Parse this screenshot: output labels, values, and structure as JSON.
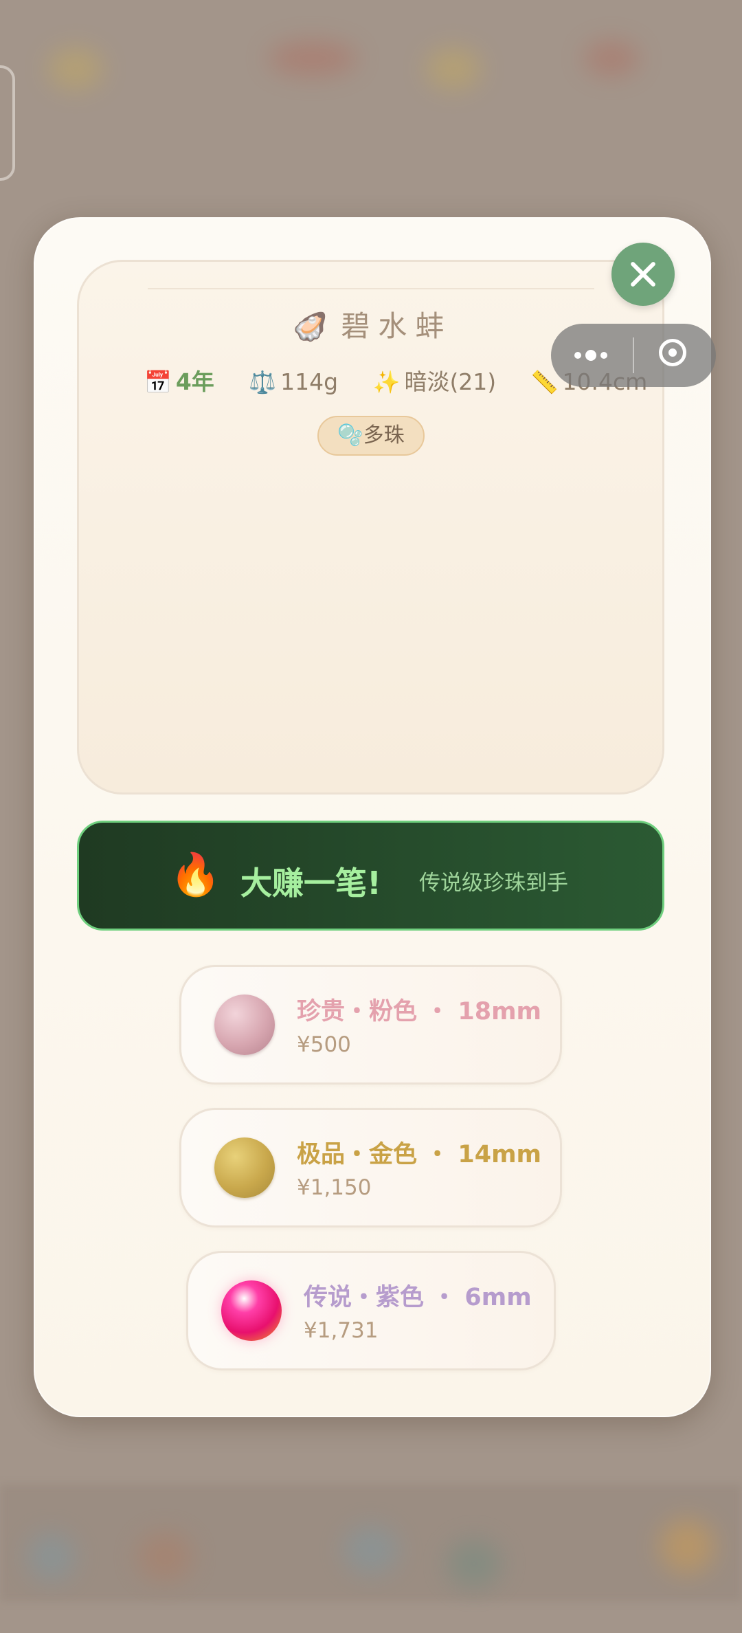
{
  "oyster": {
    "icon": "🦪",
    "name": "碧水蚌",
    "stats": {
      "age_icon": "📅",
      "age": "4年",
      "weight_icon": "⚖️",
      "weight": "114g",
      "luster_icon": "✨",
      "luster": "暗淡(21)",
      "size_icon": "📏",
      "size": "10.4cm"
    },
    "tag_icon": "🫧",
    "tag": "多珠"
  },
  "banner": {
    "icon": "🔥",
    "headline": "大赚一笔!",
    "subline": "传说级珍珠到手"
  },
  "pearls": [
    {
      "name": "珍贵・粉色 ・ 18mm",
      "price": "¥500",
      "color": "#e4a1ad"
    },
    {
      "name": "极品・金色 ・ 14mm",
      "price": "¥1,150",
      "color": "#c9a246"
    },
    {
      "name": "传说・紫色 ・ 6mm",
      "price": "¥1,731",
      "color": "#b69ccd"
    }
  ]
}
